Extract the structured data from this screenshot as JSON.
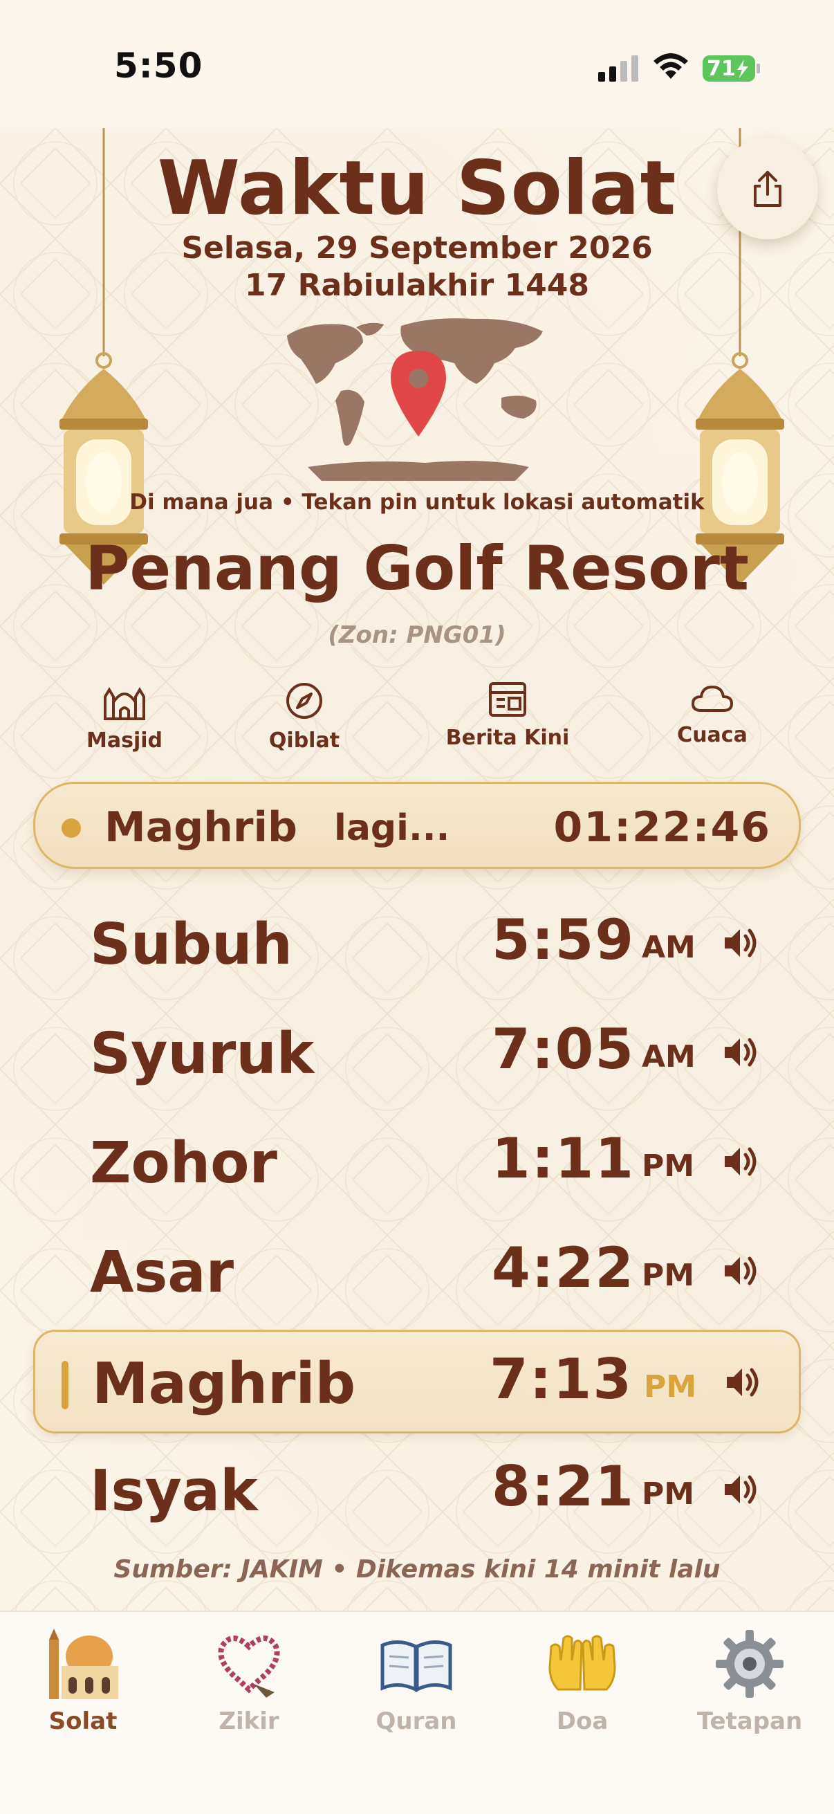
{
  "status_bar": {
    "time": "5:50",
    "battery": "71"
  },
  "header": {
    "title": "Waktu Solat",
    "date_gregorian": "Selasa, 29 September 2026",
    "date_hijri": "17 Rabiulakhir 1448"
  },
  "location": {
    "hint": "Di mana jua • Tekan pin untuk lokasi automatik",
    "name": "Penang Golf Resort",
    "zone": "(Zon: PNG01)"
  },
  "quick_links": [
    {
      "label": "Masjid",
      "icon": "mosque-icon"
    },
    {
      "label": "Qiblat",
      "icon": "compass-icon"
    },
    {
      "label": "Berita Kini",
      "icon": "newspaper-icon"
    },
    {
      "label": "Cuaca",
      "icon": "cloud-icon"
    }
  ],
  "countdown": {
    "prayer": "Maghrib",
    "label": "lagi...",
    "remaining": "01:22:46"
  },
  "prayers": [
    {
      "name": "Subuh",
      "time": "5:59",
      "ampm": "AM"
    },
    {
      "name": "Syuruk",
      "time": "7:05",
      "ampm": "AM"
    },
    {
      "name": "Zohor",
      "time": "1:11",
      "ampm": "PM"
    },
    {
      "name": "Asar",
      "time": "4:22",
      "ampm": "PM"
    },
    {
      "name": "Maghrib",
      "time": "7:13",
      "ampm": "PM",
      "active": true
    },
    {
      "name": "Isyak",
      "time": "8:21",
      "ampm": "PM"
    }
  ],
  "source": "Sumber: JAKIM • Dikemas kini 14 minit lalu",
  "tabs": [
    {
      "label": "Solat",
      "icon": "mosque-emoji-icon",
      "active": true
    },
    {
      "label": "Zikir",
      "icon": "prayer-beads-icon"
    },
    {
      "label": "Quran",
      "icon": "open-book-icon"
    },
    {
      "label": "Doa",
      "icon": "palms-up-icon"
    },
    {
      "label": "Tetapan",
      "icon": "gear-icon"
    }
  ],
  "colors": {
    "primary_brown": "#6b2f1a",
    "gold": "#d9a43d",
    "gold_border": "#dcb765",
    "background": "#fcf6ec",
    "pin_red": "#e04848",
    "battery_green": "#5cc55c"
  }
}
